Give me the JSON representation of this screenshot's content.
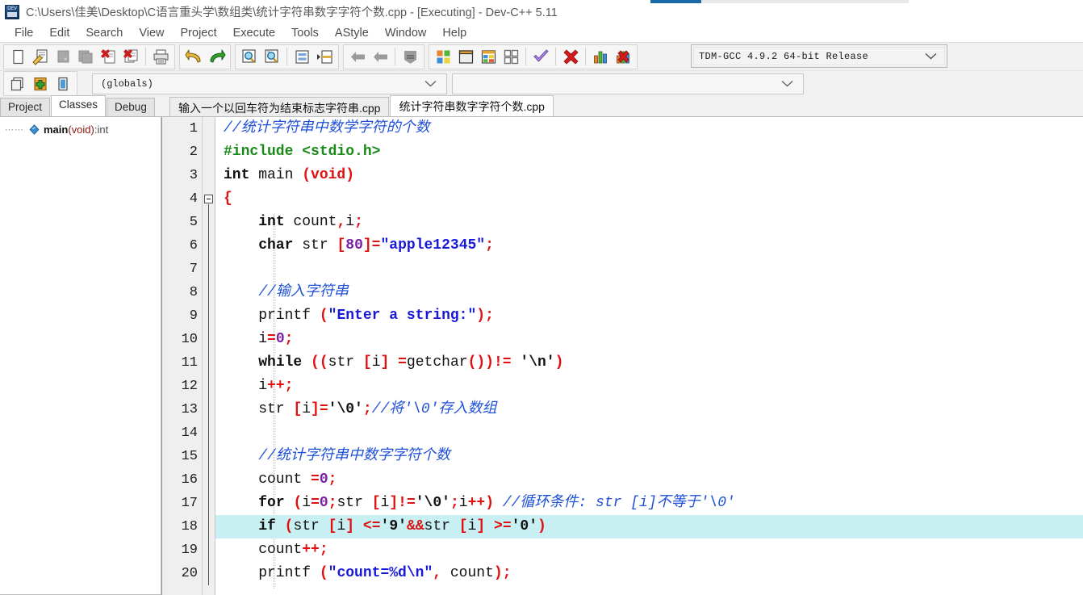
{
  "window": {
    "title": "C:\\Users\\佳美\\Desktop\\C语言重头学\\数组类\\统计字符串数字字符个数.cpp - [Executing] - Dev-C++ 5.11",
    "icon": "dev-cpp-app-icon",
    "accent_color": "#1a6aa8"
  },
  "menubar": {
    "items": [
      {
        "label": "File"
      },
      {
        "label": "Edit"
      },
      {
        "label": "Search"
      },
      {
        "label": "View"
      },
      {
        "label": "Project"
      },
      {
        "label": "Execute"
      },
      {
        "label": "Tools"
      },
      {
        "label": "AStyle"
      },
      {
        "label": "Window"
      },
      {
        "label": "Help"
      }
    ]
  },
  "toolbar": {
    "groups": [
      {
        "buttons": [
          {
            "icon": "new-file-icon",
            "label": "New"
          },
          {
            "icon": "open-file-icon",
            "label": "Open"
          },
          {
            "icon": "save-file-icon",
            "label": "Save",
            "disabled": true
          },
          {
            "icon": "save-all-icon",
            "label": "Save All",
            "disabled": true
          },
          {
            "icon": "close-file-icon",
            "label": "Close"
          },
          {
            "icon": "close-all-icon",
            "label": "Close All"
          },
          {
            "sep": true
          },
          {
            "icon": "print-icon",
            "label": "Print"
          }
        ]
      },
      {
        "buttons": [
          {
            "icon": "undo-icon",
            "label": "Undo"
          },
          {
            "icon": "redo-icon",
            "label": "Redo"
          }
        ]
      },
      {
        "buttons": [
          {
            "icon": "find-icon",
            "label": "Find"
          },
          {
            "icon": "replace-icon",
            "label": "Replace"
          },
          {
            "sep": true
          },
          {
            "icon": "goto-line-icon",
            "label": "Goto Line"
          },
          {
            "icon": "goto-function-icon",
            "label": "Goto Function"
          }
        ]
      },
      {
        "buttons": [
          {
            "icon": "back-icon",
            "label": "Back",
            "disabled": true
          },
          {
            "icon": "forward-icon",
            "label": "Forward",
            "disabled": true
          },
          {
            "sep": true
          },
          {
            "icon": "bookmark-icon",
            "label": "Bookmark",
            "disabled": true
          }
        ]
      },
      {
        "buttons": [
          {
            "icon": "compile-icon",
            "label": "Compile"
          },
          {
            "icon": "run-icon",
            "label": "Run"
          },
          {
            "icon": "compile-run-icon",
            "label": "Compile & Run"
          },
          {
            "icon": "rebuild-all-icon",
            "label": "Rebuild All"
          },
          {
            "sep": true
          },
          {
            "icon": "syntax-check-icon",
            "label": "Syntax Check"
          },
          {
            "sep": true
          },
          {
            "icon": "stop-execution-icon",
            "label": "Stop Execution"
          },
          {
            "sep": true
          },
          {
            "icon": "profile-icon",
            "label": "Profile Analysis"
          },
          {
            "icon": "delete-profile-icon",
            "label": "Delete Profile"
          }
        ]
      }
    ],
    "compiler_select": {
      "value": "TDM-GCC 4.9.2 64-bit Release",
      "icon": "chevron-down-icon"
    }
  },
  "toolbar2": {
    "buttons": [
      {
        "icon": "insert-snippet-icon",
        "label": "Insert"
      },
      {
        "icon": "add-to-project-icon",
        "label": "Add to do item"
      },
      {
        "icon": "toggle-panel-icon",
        "label": "Toggle Panel"
      }
    ],
    "scope_select": {
      "value": "(globals)",
      "icon": "chevron-down-icon"
    },
    "member_select": {
      "value": "",
      "icon": "chevron-down-icon"
    }
  },
  "panel_tabs": [
    {
      "label": "Project",
      "active": false
    },
    {
      "label": "Classes",
      "active": true
    },
    {
      "label": "Debug",
      "active": false
    }
  ],
  "editor_tabs": [
    {
      "label": "输入一个以回车符为结束标志字符串.cpp",
      "active": false
    },
    {
      "label": "统计字符串数字字符个数.cpp",
      "active": true
    }
  ],
  "class_browser": {
    "items": [
      {
        "icon": "function-member-icon",
        "name": "main",
        "args": "(void)",
        "separator": " : ",
        "return_type": "int"
      }
    ]
  },
  "code": {
    "highlight_line": 18,
    "fold_start_line": 4,
    "fold_end_line": 20,
    "lines": [
      {
        "n": 1,
        "tokens": [
          {
            "t": "//统计字符串中数学字符的个数",
            "c": "cmt"
          }
        ]
      },
      {
        "n": 2,
        "tokens": [
          {
            "t": "#include <stdio.h>",
            "c": "pre"
          }
        ]
      },
      {
        "n": 3,
        "tokens": [
          {
            "t": "int",
            "c": "kw"
          },
          {
            "t": " main ",
            "c": "idn"
          },
          {
            "t": "(void)",
            "c": "pun"
          }
        ]
      },
      {
        "n": 4,
        "tokens": [
          {
            "t": "{",
            "c": "pun"
          }
        ]
      },
      {
        "n": 5,
        "tokens": [
          {
            "t": "    ",
            "c": "idn"
          },
          {
            "t": "int",
            "c": "kw"
          },
          {
            "t": " count",
            "c": "idn"
          },
          {
            "t": ",",
            "c": "pun"
          },
          {
            "t": "i",
            "c": "idn"
          },
          {
            "t": ";",
            "c": "pun"
          }
        ]
      },
      {
        "n": 6,
        "tokens": [
          {
            "t": "    ",
            "c": "idn"
          },
          {
            "t": "char",
            "c": "kw"
          },
          {
            "t": " str ",
            "c": "idn"
          },
          {
            "t": "[",
            "c": "pun"
          },
          {
            "t": "80",
            "c": "num"
          },
          {
            "t": "]=",
            "c": "pun"
          },
          {
            "t": "\"apple12345\"",
            "c": "str"
          },
          {
            "t": ";",
            "c": "pun"
          }
        ]
      },
      {
        "n": 7,
        "tokens": []
      },
      {
        "n": 8,
        "tokens": [
          {
            "t": "    ",
            "c": "idn"
          },
          {
            "t": "//输入字符串",
            "c": "cmt"
          }
        ]
      },
      {
        "n": 9,
        "tokens": [
          {
            "t": "    printf ",
            "c": "idn"
          },
          {
            "t": "(",
            "c": "pun"
          },
          {
            "t": "\"Enter a string:\"",
            "c": "str"
          },
          {
            "t": ");",
            "c": "pun"
          }
        ]
      },
      {
        "n": 10,
        "tokens": [
          {
            "t": "    i",
            "c": "idn"
          },
          {
            "t": "=",
            "c": "pun"
          },
          {
            "t": "0",
            "c": "num"
          },
          {
            "t": ";",
            "c": "pun"
          }
        ]
      },
      {
        "n": 11,
        "tokens": [
          {
            "t": "    ",
            "c": "idn"
          },
          {
            "t": "while",
            "c": "kw"
          },
          {
            "t": " ",
            "c": "idn"
          },
          {
            "t": "((",
            "c": "pun"
          },
          {
            "t": "str ",
            "c": "idn"
          },
          {
            "t": "[",
            "c": "pun"
          },
          {
            "t": "i",
            "c": "idn"
          },
          {
            "t": "]",
            "c": "pun"
          },
          {
            "t": " ",
            "c": "idn"
          },
          {
            "t": "=",
            "c": "pun"
          },
          {
            "t": "getchar",
            "c": "idn"
          },
          {
            "t": "())",
            "c": "pun"
          },
          {
            "t": "!=",
            "c": "pun"
          },
          {
            "t": " ",
            "c": "idn"
          },
          {
            "t": "'\\n'",
            "c": "chr"
          },
          {
            "t": ")",
            "c": "pun"
          }
        ]
      },
      {
        "n": 12,
        "tokens": [
          {
            "t": "    i",
            "c": "idn"
          },
          {
            "t": "++;",
            "c": "pun"
          }
        ]
      },
      {
        "n": 13,
        "tokens": [
          {
            "t": "    str ",
            "c": "idn"
          },
          {
            "t": "[",
            "c": "pun"
          },
          {
            "t": "i",
            "c": "idn"
          },
          {
            "t": "]=",
            "c": "pun"
          },
          {
            "t": "'\\0'",
            "c": "chr"
          },
          {
            "t": ";",
            "c": "pun"
          },
          {
            "t": "//将'\\0'存入数组",
            "c": "cmt"
          }
        ]
      },
      {
        "n": 14,
        "tokens": []
      },
      {
        "n": 15,
        "tokens": [
          {
            "t": "    ",
            "c": "idn"
          },
          {
            "t": "//统计字符串中数字字符个数",
            "c": "cmt"
          }
        ]
      },
      {
        "n": 16,
        "tokens": [
          {
            "t": "    count ",
            "c": "idn"
          },
          {
            "t": "=",
            "c": "pun"
          },
          {
            "t": "0",
            "c": "num"
          },
          {
            "t": ";",
            "c": "pun"
          }
        ]
      },
      {
        "n": 17,
        "tokens": [
          {
            "t": "    ",
            "c": "idn"
          },
          {
            "t": "for",
            "c": "kw"
          },
          {
            "t": " ",
            "c": "idn"
          },
          {
            "t": "(",
            "c": "pun"
          },
          {
            "t": "i",
            "c": "idn"
          },
          {
            "t": "=",
            "c": "pun"
          },
          {
            "t": "0",
            "c": "num"
          },
          {
            "t": ";",
            "c": "pun"
          },
          {
            "t": "str ",
            "c": "idn"
          },
          {
            "t": "[",
            "c": "pun"
          },
          {
            "t": "i",
            "c": "idn"
          },
          {
            "t": "]!=",
            "c": "pun"
          },
          {
            "t": "'\\0'",
            "c": "chr"
          },
          {
            "t": ";",
            "c": "pun"
          },
          {
            "t": "i",
            "c": "idn"
          },
          {
            "t": "++)",
            "c": "pun"
          },
          {
            "t": " ",
            "c": "idn"
          },
          {
            "t": "//循环条件: str [i]不等于'\\0'",
            "c": "cmt"
          }
        ]
      },
      {
        "n": 18,
        "tokens": [
          {
            "t": "    ",
            "c": "idn"
          },
          {
            "t": "if",
            "c": "kw"
          },
          {
            "t": " ",
            "c": "idn"
          },
          {
            "t": "(",
            "c": "pun"
          },
          {
            "t": "str ",
            "c": "idn"
          },
          {
            "t": "[",
            "c": "pun"
          },
          {
            "t": "i",
            "c": "idn"
          },
          {
            "t": "]",
            "c": "pun"
          },
          {
            "t": " ",
            "c": "idn"
          },
          {
            "t": "<=",
            "c": "pun"
          },
          {
            "t": "'9'",
            "c": "chr"
          },
          {
            "t": "&&",
            "c": "pun"
          },
          {
            "t": "str ",
            "c": "idn"
          },
          {
            "t": "[",
            "c": "pun"
          },
          {
            "t": "i",
            "c": "idn"
          },
          {
            "t": "]",
            "c": "pun"
          },
          {
            "t": " ",
            "c": "idn"
          },
          {
            "t": ">=",
            "c": "pun"
          },
          {
            "t": "'0'",
            "c": "chr"
          },
          {
            "t": ")",
            "c": "pun"
          }
        ]
      },
      {
        "n": 19,
        "tokens": [
          {
            "t": "    count",
            "c": "idn"
          },
          {
            "t": "++;",
            "c": "pun"
          }
        ]
      },
      {
        "n": 20,
        "tokens": [
          {
            "t": "    printf ",
            "c": "idn"
          },
          {
            "t": "(",
            "c": "pun"
          },
          {
            "t": "\"count=%d\\n\"",
            "c": "str"
          },
          {
            "t": ", ",
            "c": "pun"
          },
          {
            "t": "count",
            "c": "idn"
          },
          {
            "t": ");",
            "c": "pun"
          }
        ]
      }
    ]
  }
}
